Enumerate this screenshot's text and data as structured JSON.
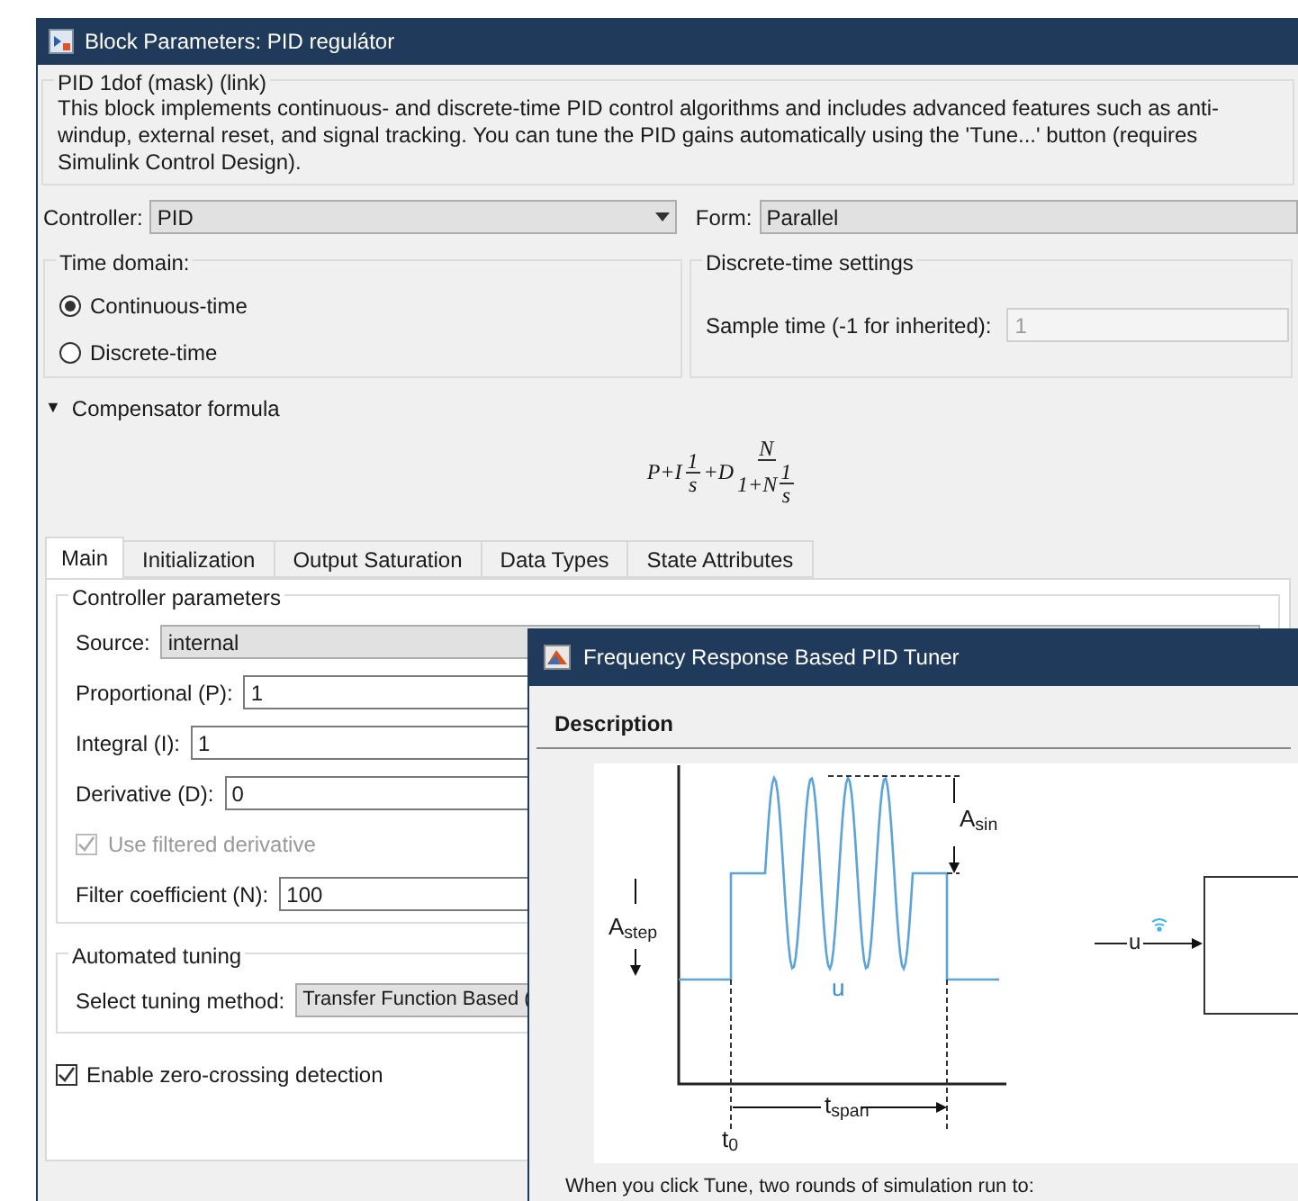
{
  "window": {
    "title": "Block Parameters: PID regulátor"
  },
  "mask": {
    "title": "PID 1dof (mask) (link)",
    "description": "This block implements continuous- and discrete-time PID control algorithms and includes advanced features such as anti-windup, external reset, and signal tracking. You can tune the PID gains automatically using the 'Tune...' button (requires Simulink Control Design)."
  },
  "controller": {
    "label": "Controller:",
    "value": "PID"
  },
  "form": {
    "label": "Form:",
    "value": "Parallel"
  },
  "time_domain": {
    "title": "Time domain:",
    "options": [
      {
        "label": "Continuous-time",
        "selected": true
      },
      {
        "label": "Discrete-time",
        "selected": false
      }
    ]
  },
  "discrete_settings": {
    "title": "Discrete-time settings",
    "sample_time": {
      "label": "Sample time (-1 for inherited):",
      "value": "1",
      "disabled": true
    }
  },
  "compensator": {
    "label": "Compensator formula",
    "expanded": true,
    "glyph": "▼",
    "formula": {
      "lead": "P+I",
      "frac1_num": "1",
      "frac1_den": "s",
      "mid": "+D",
      "frac2_num": "N",
      "frac2_den_lead": "1+N",
      "inner_num": "1",
      "inner_den": "s"
    }
  },
  "tabs": [
    {
      "label": "Main",
      "selected": true
    },
    {
      "label": "Initialization",
      "selected": false
    },
    {
      "label": "Output Saturation",
      "selected": false
    },
    {
      "label": "Data Types",
      "selected": false
    },
    {
      "label": "State Attributes",
      "selected": false
    }
  ],
  "controller_parameters": {
    "title": "Controller parameters",
    "rows": [
      {
        "kind": "dropdown",
        "label": "Source:",
        "value": "internal"
      },
      {
        "kind": "field",
        "label": "Proportional (P):",
        "value": "1"
      },
      {
        "kind": "field",
        "label": "Integral (I):",
        "value": "1"
      },
      {
        "kind": "field",
        "label": "Derivative (D):",
        "value": "0"
      },
      {
        "kind": "checkbox",
        "label": "Use filtered derivative",
        "checked": true,
        "disabled": true
      },
      {
        "kind": "field",
        "label": "Filter coefficient (N):",
        "value": "100"
      }
    ]
  },
  "automated_tuning": {
    "title": "Automated tuning",
    "label": "Select tuning method:",
    "value": "Transfer Function Based ("
  },
  "zero_crossing": {
    "label": "Enable zero-crossing detection",
    "checked": true
  },
  "tuner": {
    "title": "Frequency Response Based PID Tuner",
    "section": "Description",
    "diagram_labels": {
      "a_sin": "A$_{sin}$",
      "a_step": "A$_{step}$",
      "u_signal": "u",
      "t_span": "t$_{span}$",
      "t_0": "t$_{0}$",
      "u_input": "u"
    },
    "text": "When you click Tune, two rounds of simulation run to:"
  }
}
